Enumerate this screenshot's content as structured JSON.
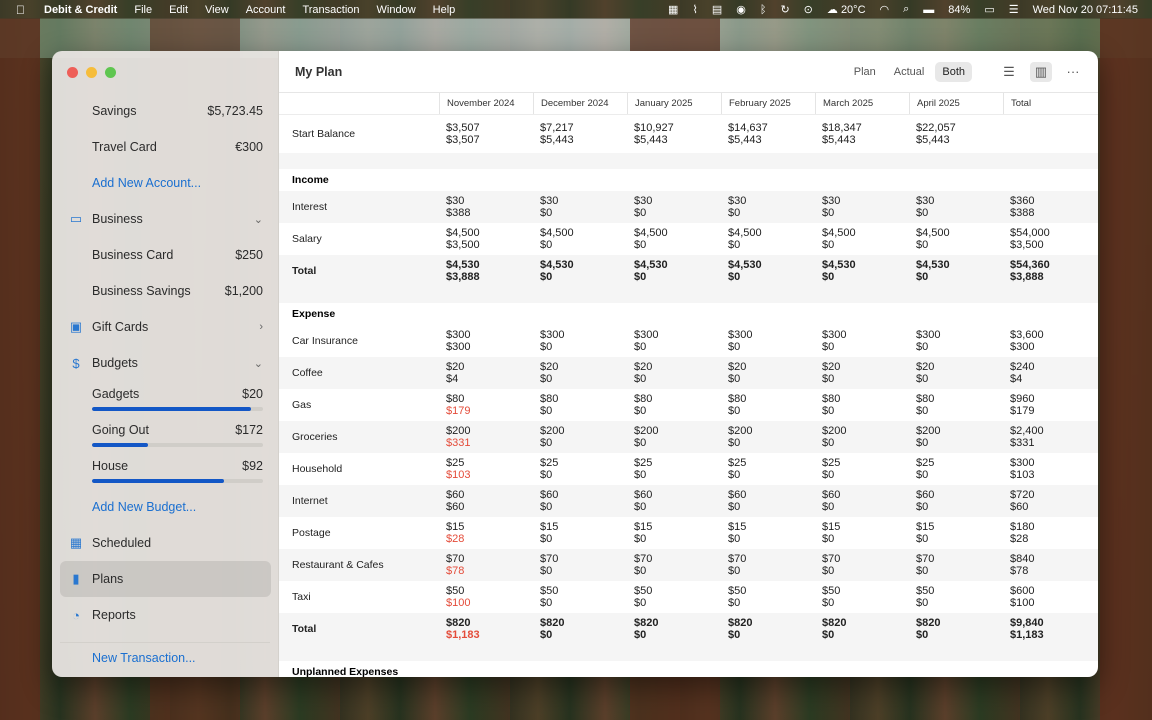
{
  "menubar": {
    "app": "Debit & Credit",
    "items": [
      "File",
      "Edit",
      "View",
      "Account",
      "Transaction",
      "Window",
      "Help"
    ],
    "weather": "20°C",
    "battery": "84%",
    "datetime": "Wed Nov 20  07:11:45"
  },
  "sidebar": {
    "savings": {
      "label": "Savings",
      "amount": "$5,723.45"
    },
    "travel": {
      "label": "Travel Card",
      "amount": "€300"
    },
    "add_account": "Add New Account...",
    "business": "Business",
    "business_card": {
      "label": "Business Card",
      "amount": "$250"
    },
    "business_savings": {
      "label": "Business Savings",
      "amount": "$1,200"
    },
    "gift_cards": "Gift Cards",
    "budgets": "Budgets",
    "budget_items": [
      {
        "label": "Gadgets",
        "amount": "$20",
        "fill": 0.93
      },
      {
        "label": "Going Out",
        "amount": "$172",
        "fill": 0.33
      },
      {
        "label": "House",
        "amount": "$92",
        "fill": 0.77
      }
    ],
    "add_budget": "Add New Budget...",
    "scheduled": "Scheduled",
    "plans": "Plans",
    "reports": "Reports",
    "new_transaction": "New Transaction..."
  },
  "toolbar": {
    "title": "My Plan",
    "segments": [
      "Plan",
      "Actual",
      "Both"
    ],
    "selected": "Both"
  },
  "columns": [
    "November 2024",
    "December 2024",
    "January 2025",
    "February 2025",
    "March 2025",
    "April 2025",
    "Total"
  ],
  "start_balance": {
    "label": "Start Balance",
    "plan": [
      "$3,507",
      "$7,217",
      "$10,927",
      "$14,637",
      "$18,347",
      "$22,057",
      ""
    ],
    "actual": [
      "$3,507",
      "$5,443",
      "$5,443",
      "$5,443",
      "$5,443",
      "$5,443",
      ""
    ]
  },
  "income": {
    "title": "Income",
    "rows": [
      {
        "label": "Interest",
        "plan": [
          "$30",
          "$30",
          "$30",
          "$30",
          "$30",
          "$30",
          "$360"
        ],
        "actual": [
          "$388",
          "$0",
          "$0",
          "$0",
          "$0",
          "$0",
          "$388"
        ]
      },
      {
        "label": "Salary",
        "plan": [
          "$4,500",
          "$4,500",
          "$4,500",
          "$4,500",
          "$4,500",
          "$4,500",
          "$54,000"
        ],
        "actual": [
          "$3,500",
          "$0",
          "$0",
          "$0",
          "$0",
          "$0",
          "$3,500"
        ]
      }
    ],
    "total": {
      "label": "Total",
      "plan": [
        "$4,530",
        "$4,530",
        "$4,530",
        "$4,530",
        "$4,530",
        "$4,530",
        "$54,360"
      ],
      "actual": [
        "$3,888",
        "$0",
        "$0",
        "$0",
        "$0",
        "$0",
        "$3,888"
      ]
    }
  },
  "expense": {
    "title": "Expense",
    "rows": [
      {
        "label": "Car Insurance",
        "plan": [
          "$300",
          "$300",
          "$300",
          "$300",
          "$300",
          "$300",
          "$3,600"
        ],
        "actual": [
          "$300",
          "$0",
          "$0",
          "$0",
          "$0",
          "$0",
          "$300"
        ],
        "over": false
      },
      {
        "label": "Coffee",
        "plan": [
          "$20",
          "$20",
          "$20",
          "$20",
          "$20",
          "$20",
          "$240"
        ],
        "actual": [
          "$4",
          "$0",
          "$0",
          "$0",
          "$0",
          "$0",
          "$4"
        ],
        "over": false
      },
      {
        "label": "Gas",
        "plan": [
          "$80",
          "$80",
          "$80",
          "$80",
          "$80",
          "$80",
          "$960"
        ],
        "actual": [
          "$179",
          "$0",
          "$0",
          "$0",
          "$0",
          "$0",
          "$179"
        ],
        "over": true
      },
      {
        "label": "Groceries",
        "plan": [
          "$200",
          "$200",
          "$200",
          "$200",
          "$200",
          "$200",
          "$2,400"
        ],
        "actual": [
          "$331",
          "$0",
          "$0",
          "$0",
          "$0",
          "$0",
          "$331"
        ],
        "over": true
      },
      {
        "label": "Household",
        "plan": [
          "$25",
          "$25",
          "$25",
          "$25",
          "$25",
          "$25",
          "$300"
        ],
        "actual": [
          "$103",
          "$0",
          "$0",
          "$0",
          "$0",
          "$0",
          "$103"
        ],
        "over": true
      },
      {
        "label": "Internet",
        "plan": [
          "$60",
          "$60",
          "$60",
          "$60",
          "$60",
          "$60",
          "$720"
        ],
        "actual": [
          "$60",
          "$0",
          "$0",
          "$0",
          "$0",
          "$0",
          "$60"
        ],
        "over": false
      },
      {
        "label": "Postage",
        "plan": [
          "$15",
          "$15",
          "$15",
          "$15",
          "$15",
          "$15",
          "$180"
        ],
        "actual": [
          "$28",
          "$0",
          "$0",
          "$0",
          "$0",
          "$0",
          "$28"
        ],
        "over": true
      },
      {
        "label": "Restaurant & Cafes",
        "plan": [
          "$70",
          "$70",
          "$70",
          "$70",
          "$70",
          "$70",
          "$840"
        ],
        "actual": [
          "$78",
          "$0",
          "$0",
          "$0",
          "$0",
          "$0",
          "$78"
        ],
        "over": true
      },
      {
        "label": "Taxi",
        "plan": [
          "$50",
          "$50",
          "$50",
          "$50",
          "$50",
          "$50",
          "$600"
        ],
        "actual": [
          "$100",
          "$0",
          "$0",
          "$0",
          "$0",
          "$0",
          "$100"
        ],
        "over": true
      }
    ],
    "total": {
      "label": "Total",
      "plan": [
        "$820",
        "$820",
        "$820",
        "$820",
        "$820",
        "$820",
        "$9,840"
      ],
      "actual": [
        "$1,183",
        "$0",
        "$0",
        "$0",
        "$0",
        "$0",
        "$1,183"
      ],
      "over": true
    }
  },
  "unplanned": {
    "title": "Unplanned Expenses"
  }
}
